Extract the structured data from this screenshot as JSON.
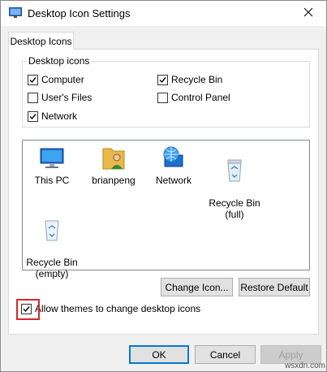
{
  "window": {
    "title": "Desktop Icon Settings",
    "app_icon": "desktop-settings-icon",
    "close_icon": "close-icon"
  },
  "tabs": [
    {
      "label": "Desktop Icons",
      "active": true
    }
  ],
  "desktop_icons_group": {
    "title": "Desktop icons",
    "checkboxes": [
      {
        "label": "Computer",
        "checked": true
      },
      {
        "label": "Recycle Bin",
        "checked": true
      },
      {
        "label": "User's Files",
        "checked": false
      },
      {
        "label": "Control Panel",
        "checked": false
      },
      {
        "label": "Network",
        "checked": true
      }
    ]
  },
  "icon_list": {
    "items": [
      {
        "label": "This PC",
        "icon": "this-pc-icon"
      },
      {
        "label": "brianpeng",
        "icon": "user-folder-icon"
      },
      {
        "label": "Network",
        "icon": "network-icon"
      },
      {
        "label": "Recycle Bin\n(full)",
        "icon": "recycle-bin-full-icon"
      },
      {
        "label": "Recycle Bin\n(empty)",
        "icon": "recycle-bin-empty-icon"
      }
    ]
  },
  "buttons": {
    "change_icon": "Change Icon...",
    "restore_default": "Restore Default",
    "ok": "OK",
    "cancel": "Cancel",
    "apply": "Apply"
  },
  "allow_themes": {
    "label": "Allow themes to change desktop icons",
    "checked": true
  },
  "colors": {
    "highlight_box": "#d9262a",
    "default_button_border": "#0078d7"
  },
  "watermark": "wsxdn.com"
}
